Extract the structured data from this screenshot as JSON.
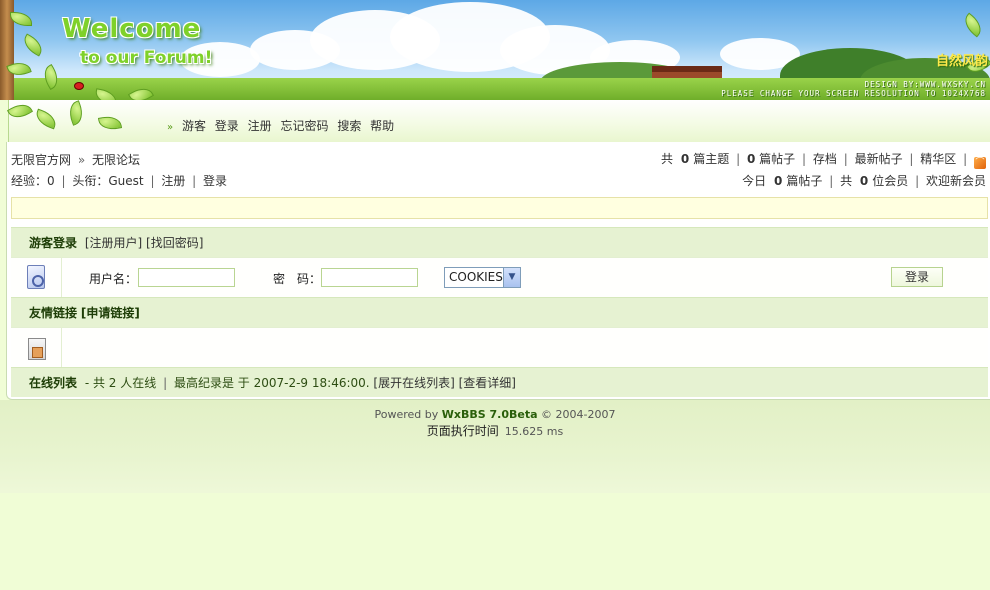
{
  "banner": {
    "welcome": "Welcome",
    "subtitle": "to our Forum!",
    "brand": "自然风韵",
    "design": "DESIGN BY:WWW.WXSKY.CN",
    "resolution": "PLEASE CHANGE YOUR SCREEN RESOLUTION TO 1024X768"
  },
  "nav": {
    "items": [
      "游客",
      "登录",
      "注册",
      "忘记密码",
      "搜索",
      "帮助"
    ]
  },
  "breadcrumb": {
    "home": "无限官方网",
    "arrow": "»",
    "forum": "无限论坛"
  },
  "stats": {
    "total_prefix": "共",
    "topics": "0",
    "topics_label": "篇主题",
    "posts": "0",
    "posts_label": "篇帖子",
    "archive": "存档",
    "latest": "最新帖子",
    "digest": "精华区"
  },
  "user_info": {
    "exp_label": "经验：",
    "exp_value": "0",
    "title_label": "头衔：",
    "title_value": "Guest",
    "register": "注册",
    "login": "登录"
  },
  "today": {
    "prefix": "今日",
    "posts": "0",
    "posts_label": "篇帖子",
    "members_prefix": "共",
    "members": "0",
    "members_label": "位会员",
    "welcome": "欢迎新会员"
  },
  "guest_login": {
    "title": "游客登录",
    "register_link": "[注册用户]",
    "recover_link": "[找回密码]",
    "username_label": "用户名：",
    "password_label": "密　码：",
    "cookies_value": "COOKIES",
    "submit_label": "登录"
  },
  "friend_links": {
    "title": "友情链接",
    "apply_link": "[申请链接]"
  },
  "online": {
    "title": "在线列表",
    "summary": "- 共 2 人在线",
    "record": "最高纪录是 于 2007-2-9 18:46:00.",
    "expand_link": "[展开在线列表]",
    "details_link": "[查看详细]"
  },
  "footer": {
    "powered_prefix": "Powered by",
    "product": "WxBBS 7.0Beta",
    "copyright": "© 2004-2007",
    "exec_label": "页面执行时间",
    "exec_value": "15.625 ms"
  },
  "colors": {
    "page_bg": "#f0fdd6",
    "section_bg": "#e6f2d2",
    "accent_green": "#7fd12a",
    "notice_bg": "#ffffe0"
  },
  "icons": [
    "rss-icon",
    "doc-icon",
    "home-icon",
    "ladybug-icon"
  ]
}
